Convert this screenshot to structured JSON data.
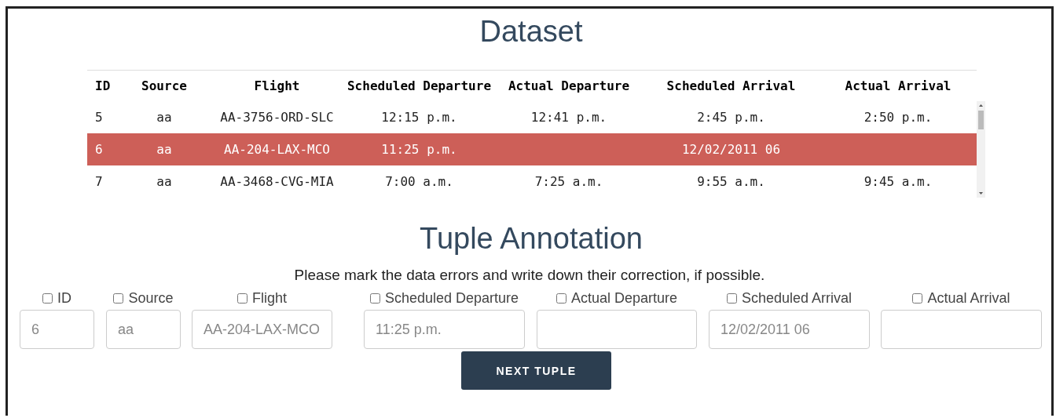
{
  "title": "Dataset",
  "table": {
    "columns": [
      "ID",
      "Source",
      "Flight",
      "Scheduled Departure",
      "Actual Departure",
      "Scheduled Arrival",
      "Actual Arrival"
    ],
    "rows": [
      {
        "selected": false,
        "cells": [
          "5",
          "aa",
          "AA-3756-ORD-SLC",
          "12:15 p.m.",
          "12:41 p.m.",
          "2:45 p.m.",
          "2:50 p.m."
        ]
      },
      {
        "selected": true,
        "cells": [
          "6",
          "aa",
          "AA-204-LAX-MCO",
          "11:25 p.m.",
          null,
          "12/02/2011 06",
          null
        ]
      },
      {
        "selected": false,
        "cells": [
          "7",
          "aa",
          "AA-3468-CVG-MIA",
          "7:00 a.m.",
          "7:25 a.m.",
          "9:55 a.m.",
          "9:45 a.m."
        ]
      }
    ]
  },
  "annotation": {
    "title": "Tuple Annotation",
    "instruction": "Please mark the data errors and write down their correction, if possible.",
    "fields": [
      {
        "label": "ID",
        "checked": false,
        "value": "6"
      },
      {
        "label": "Source",
        "checked": false,
        "value": "aa"
      },
      {
        "label": "Flight",
        "checked": false,
        "value": "AA-204-LAX-MCO"
      },
      {
        "label": "Scheduled Departure",
        "checked": false,
        "value": "11:25 p.m."
      },
      {
        "label": "Actual Departure",
        "checked": false
      },
      {
        "label": "Scheduled Arrival",
        "checked": false,
        "value": "12/02/2011 06"
      },
      {
        "label": "Actual Arrival",
        "checked": false
      }
    ],
    "button": "NEXT TUPLE"
  }
}
